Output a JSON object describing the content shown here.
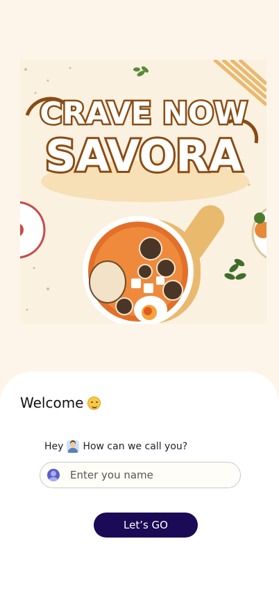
{
  "hero": {
    "logo_line1": "CRAVE NOW",
    "logo_line2": "SAVORA"
  },
  "welcome": {
    "title": "Welcome",
    "emoji": "smiling-face"
  },
  "prompt": {
    "prefix": "Hey",
    "emoji": "person-raising-hand",
    "question": "How can we call you?"
  },
  "name_input": {
    "placeholder": "Enter you name",
    "value": ""
  },
  "cta": {
    "label": "Let’s GO"
  },
  "colors": {
    "background": "#fdf5ea",
    "sheet": "#ffffff",
    "button": "#1b0a56",
    "logo_brown": "#8a4b12",
    "user_icon": "#5b5fc7"
  }
}
